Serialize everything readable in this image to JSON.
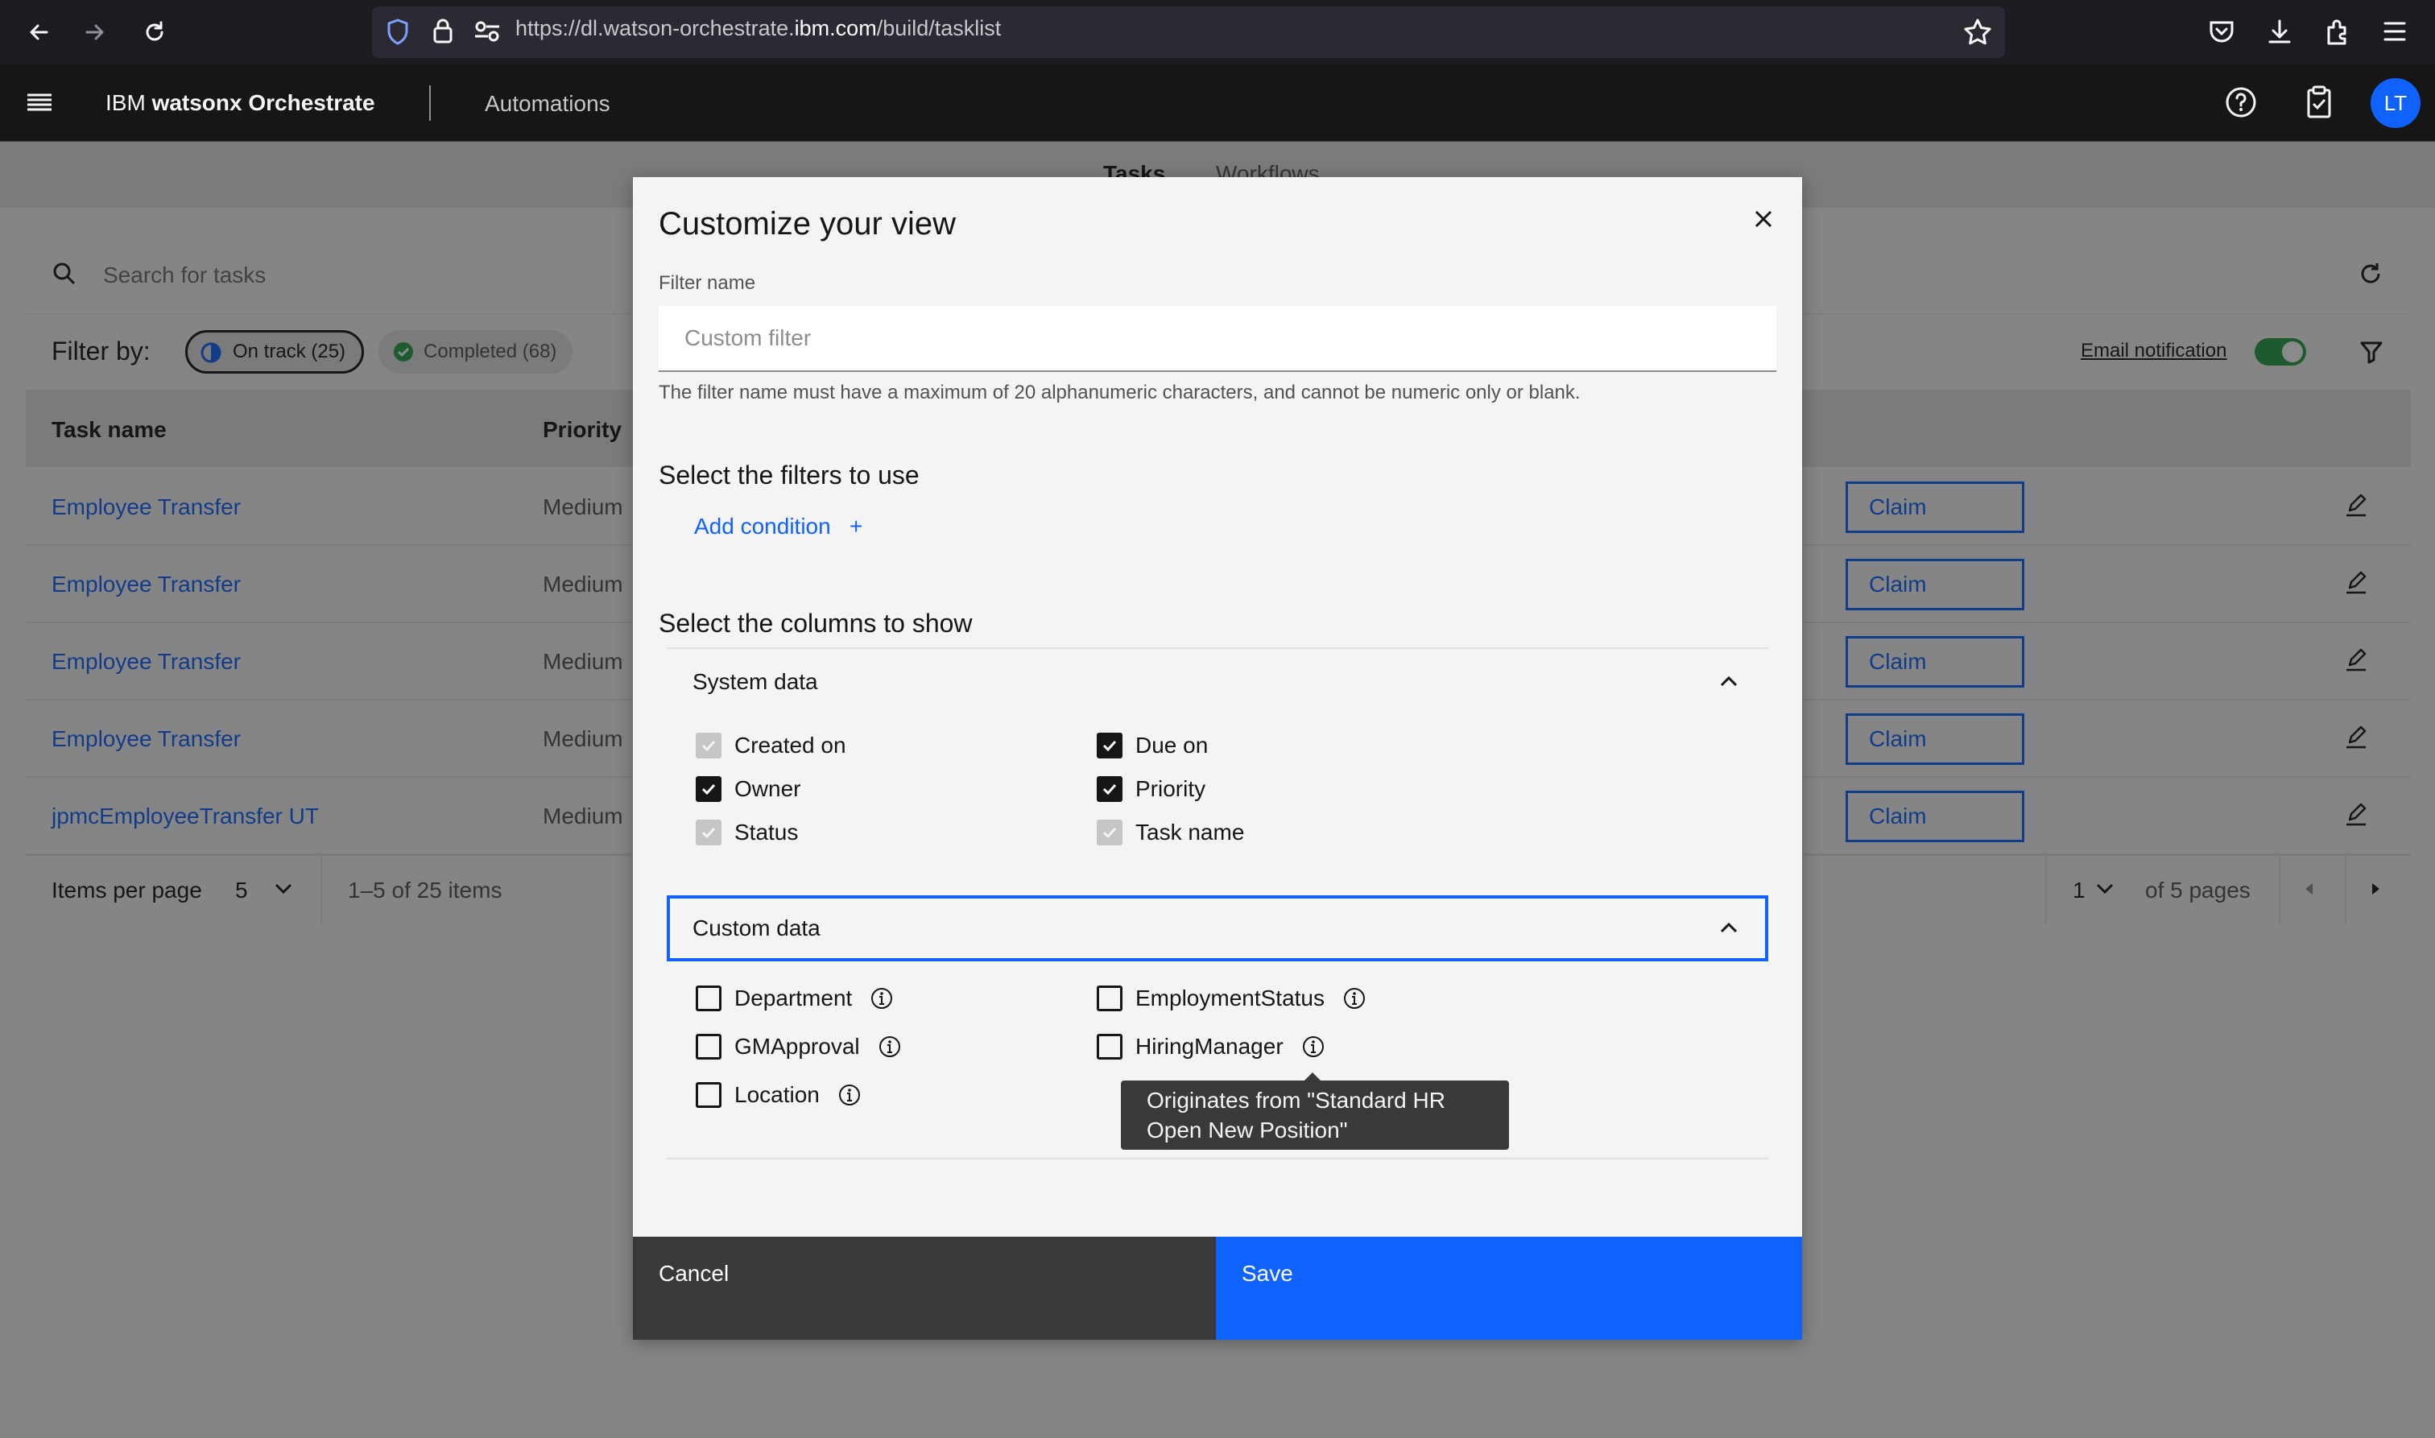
{
  "browser": {
    "url_prefix": "https://dl.watson-orchestrate.",
    "url_domain": "ibm.com",
    "url_suffix": "/build/tasklist"
  },
  "header": {
    "brand_prefix": "IBM",
    "brand_name": "watsonx Orchestrate",
    "section": "Automations",
    "avatar_initials": "LT"
  },
  "page": {
    "tabs": [
      "Tasks",
      "Workflows"
    ],
    "search_placeholder": "Search for tasks",
    "filter_by_label": "Filter by:",
    "pills": [
      {
        "label": "On track (25)"
      },
      {
        "label": "Completed (68)"
      }
    ],
    "email_notification_label": "Email notification",
    "columns": {
      "task_name": "Task name",
      "priority": "Priority"
    },
    "rows": [
      {
        "task": "Employee Transfer",
        "priority": "Medium",
        "action": "Claim"
      },
      {
        "task": "Employee Transfer",
        "priority": "Medium",
        "action": "Claim"
      },
      {
        "task": "Employee Transfer",
        "priority": "Medium",
        "action": "Claim"
      },
      {
        "task": "Employee Transfer",
        "priority": "Medium",
        "action": "Claim"
      },
      {
        "task": "jpmcEmployeeTransfer UT",
        "priority": "Medium",
        "action": "Claim"
      }
    ],
    "pager": {
      "items_per_page_label": "Items per page",
      "items_per_page_value": "5",
      "range_text": "1–5 of 25 items",
      "page_value": "1",
      "pages_text": "of 5 pages"
    }
  },
  "modal": {
    "title": "Customize your view",
    "filter_name_label": "Filter name",
    "filter_name_placeholder": "Custom filter",
    "filter_name_value": "",
    "filter_helper": "The filter name must have a maximum of 20 alphanumeric characters, and cannot be numeric only or blank.",
    "filters_heading": "Select the filters to use",
    "add_condition_label": "Add condition",
    "add_condition_icon": "+",
    "columns_heading": "Select the columns to show",
    "system_data": {
      "title": "System data",
      "items": [
        {
          "label": "Created on",
          "state": "disabled-checked"
        },
        {
          "label": "Due on",
          "state": "checked"
        },
        {
          "label": "Owner",
          "state": "checked"
        },
        {
          "label": "Priority",
          "state": "checked"
        },
        {
          "label": "Status",
          "state": "disabled-checked"
        },
        {
          "label": "Task name",
          "state": "disabled-checked"
        }
      ]
    },
    "custom_data": {
      "title": "Custom data",
      "items": [
        {
          "label": "Department",
          "state": "unchecked"
        },
        {
          "label": "EmploymentStatus",
          "state": "unchecked"
        },
        {
          "label": "GMApproval",
          "state": "unchecked"
        },
        {
          "label": "HiringManager",
          "state": "unchecked"
        },
        {
          "label": "Location",
          "state": "unchecked"
        }
      ]
    },
    "tooltip": "Originates from \"Standard HR Open New Position\"",
    "cancel_label": "Cancel",
    "save_label": "Save"
  },
  "colors": {
    "primary_blue": "#0f62fe",
    "header_bg": "#161616",
    "toggle_green": "#24a148",
    "secondary_button": "#393939"
  }
}
